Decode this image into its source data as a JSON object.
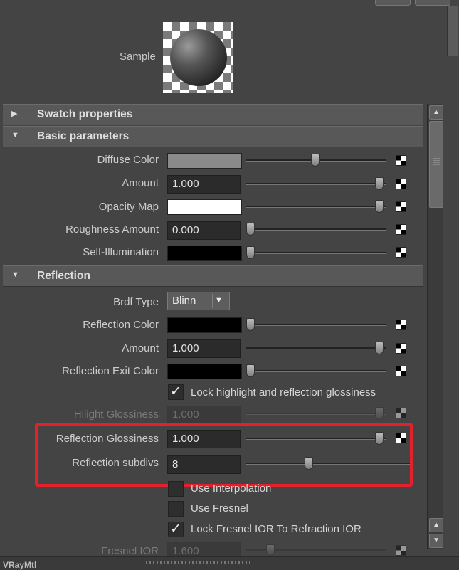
{
  "sample": {
    "label": "Sample"
  },
  "sections": {
    "swatch": "Swatch properties",
    "basic": "Basic parameters",
    "reflection": "Reflection"
  },
  "basic": {
    "diffuse_color": {
      "label": "Diffuse Color",
      "color": "#8a8a8a",
      "slider": 0.49
    },
    "amount": {
      "label": "Amount",
      "value": "1.000",
      "slider": 1.0
    },
    "opacity_map": {
      "label": "Opacity Map",
      "color": "#ffffff",
      "slider": 1.0
    },
    "roughness_amount": {
      "label": "Roughness Amount",
      "value": "0.000",
      "slider": 0.0
    },
    "self_illumination": {
      "label": "Self-Illumination",
      "color": "#000000",
      "slider": 0.0
    }
  },
  "reflection": {
    "brdf_type": {
      "label": "Brdf Type",
      "value": "Blinn"
    },
    "reflection_color": {
      "label": "Reflection Color",
      "color": "#000000",
      "slider": 0.0
    },
    "amount": {
      "label": "Amount",
      "value": "1.000",
      "slider": 1.0
    },
    "exit_color": {
      "label": "Reflection Exit Color",
      "color": "#000000",
      "slider": 0.0
    },
    "lock_highlight": {
      "label": "Lock highlight and reflection glossiness",
      "checked": true
    },
    "hilight_glossiness": {
      "label": "Hilight Glossiness",
      "value": "1.000",
      "slider": 1.0
    },
    "glossiness": {
      "label": "Reflection Glossiness",
      "value": "1.000",
      "slider": 1.0
    },
    "subdivs": {
      "label": "Reflection subdivs",
      "value": "8",
      "slider": 0.38
    },
    "use_interpolation": {
      "label": "Use Interpolation",
      "checked": false
    },
    "use_fresnel": {
      "label": "Use Fresnel",
      "checked": false
    },
    "lock_fresnel_ior": {
      "label": "Lock Fresnel IOR To Refraction IOR",
      "checked": true
    },
    "fresnel_ior": {
      "label": "Fresnel IOR",
      "value": "1.600"
    }
  },
  "footer": {
    "text": "VRayMtl"
  },
  "colors": {
    "highlight": "#e5202b",
    "panel": "#444444",
    "header": "#585858"
  },
  "icons": {
    "expand": "triangle-right-icon",
    "collapse": "triangle-down-icon",
    "map": "checker-map-icon",
    "check": "checkmark-icon"
  }
}
